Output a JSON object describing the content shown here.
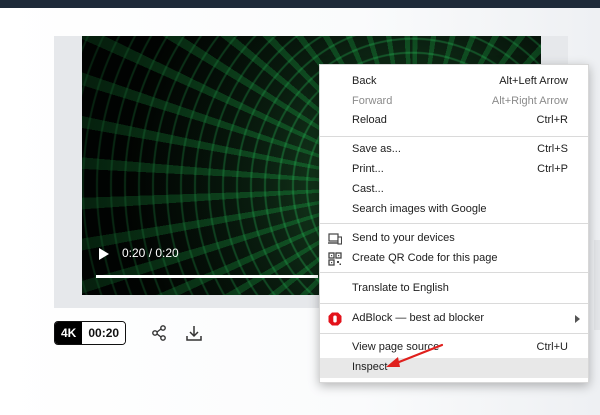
{
  "player": {
    "time": "0:20 / 0:20",
    "quality_badge": "4K",
    "duration_badge": "00:20"
  },
  "actions": {
    "share_icon": "share-icon",
    "download_icon": "download-icon"
  },
  "context_menu": {
    "items": [
      {
        "label": "Back",
        "shortcut": "Alt+Left Arrow"
      },
      {
        "label": "Forward",
        "shortcut": "Alt+Right Arrow",
        "disabled": true
      },
      {
        "label": "Reload",
        "shortcut": "Ctrl+R"
      },
      {
        "label": "Save as...",
        "shortcut": "Ctrl+S"
      },
      {
        "label": "Print...",
        "shortcut": "Ctrl+P"
      },
      {
        "label": "Cast..."
      },
      {
        "label": "Search images with Google"
      },
      {
        "label": "Send to your devices",
        "icon": "device-icon"
      },
      {
        "label": "Create QR Code for this page",
        "icon": "qr-code-icon"
      },
      {
        "label": "Translate to English"
      },
      {
        "label": "AdBlock — best ad blocker",
        "icon": "adblock-icon",
        "submenu": true
      },
      {
        "label": "View page source",
        "shortcut": "Ctrl+U"
      },
      {
        "label": "Inspect",
        "highlighted": true
      }
    ]
  },
  "colors": {
    "header": "#1e2a39",
    "adblock_red": "#e3121b",
    "annotation_arrow": "#e0201d"
  }
}
